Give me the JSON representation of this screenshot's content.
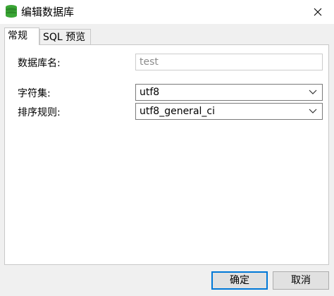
{
  "window": {
    "title": "编辑数据库",
    "icons": {
      "app": "database-icon",
      "close": "close-icon"
    }
  },
  "tabs": [
    {
      "label": "常规",
      "active": true
    },
    {
      "label": "SQL 预览",
      "active": false
    }
  ],
  "form": {
    "db_name_label": "数据库名:",
    "db_name_value": "test",
    "charset_label": "字符集:",
    "charset_value": "utf8",
    "collation_label": "排序规则:",
    "collation_value": "utf8_general_ci"
  },
  "buttons": {
    "ok": "确定",
    "cancel": "取消"
  },
  "colors": {
    "accent": "#0078d7",
    "icon_green": "#3aa635"
  }
}
